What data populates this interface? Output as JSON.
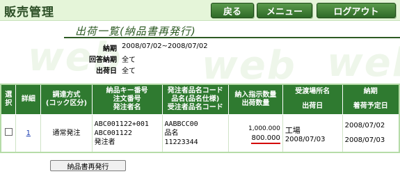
{
  "app": {
    "title": "販売管理"
  },
  "nav": {
    "back": "戻る",
    "menu": "メニュー",
    "logout": "ログアウト"
  },
  "page": {
    "title": "出荷一覧(納品書再発行)"
  },
  "criteria": [
    {
      "label": "納期",
      "value": "2008/07/02~2008/07/02"
    },
    {
      "label": "回答納期",
      "value": "全て"
    },
    {
      "label": "出荷日",
      "value": "全て"
    }
  ],
  "table": {
    "headers": {
      "select": "選択",
      "detail": "詳細",
      "method_1": "調達方式",
      "method_2": "(コック区分)",
      "key_1": "納品キー番号",
      "key_2": "注文番号",
      "key_3": "発注者名",
      "item_1": "発注者品名コード",
      "item_2": "品名(品名仕様)",
      "item_3": "受注者品名コード",
      "qty_1": "納入指示数量",
      "qty_2": "出荷数量",
      "place_1": "受渡場所名",
      "place_2": "出荷日",
      "due_1": "納期",
      "due_2": "着荷予定日"
    },
    "rows": [
      {
        "detail": "1",
        "method": "通常発注",
        "key_no": "ABC001122+001",
        "order_no": "ABC001122",
        "orderer": "発注者",
        "item_code": "AABBCC00",
        "item_name": "品名",
        "supplier_item_code": "11223344",
        "instructed_qty": "1,000.000",
        "shipped_qty": "800.000",
        "place": "工場",
        "ship_date": "2008/07/03",
        "due_date": "2008/07/02",
        "arrival_date": "2008/07/03"
      }
    ]
  },
  "actions": {
    "reissue": "納品書再発行"
  },
  "watermark": {
    "text": "web"
  },
  "colors": {
    "header_green": "#2f7a30",
    "accent_red": "#d40000",
    "link_blue": "#1a3bb0"
  }
}
